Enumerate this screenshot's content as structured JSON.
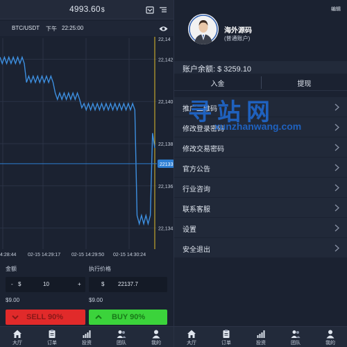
{
  "left": {
    "balance": "4993.60",
    "currency": "$",
    "pair": "BTC/USDT",
    "ampm": "下午",
    "clock": "22:25:00",
    "chart_data": {
      "type": "line",
      "x_labels": [
        "4:28:44",
        "02-15 14:29:17",
        "02-15 14:29:50",
        "02-15 14:30:24"
      ],
      "y_labels": [
        "22,142",
        "22,140",
        "22,138",
        "22,136",
        "22,134"
      ],
      "current_price_label": "22133",
      "ylim": [
        22133,
        22143
      ],
      "values": [
        22142.1,
        22141.8,
        22142.1,
        22141.8,
        22142.1,
        22141.8,
        22142.1,
        22141.8,
        22142.1,
        22141.8,
        22142.1,
        22141.8,
        22140.9,
        22141.2,
        22140.9,
        22141.2,
        22140.9,
        22141.2,
        22140.9,
        22141.2,
        22140.9,
        22141.2,
        22140.9,
        22141.2,
        22140.9,
        22140.4,
        22140.1,
        22140.4,
        22140.1,
        22140.4,
        22140.1,
        22140.4,
        22140.1,
        22140.4,
        22140.1,
        22140.4,
        22140.1,
        22139.7,
        22139.9,
        22139.6,
        22139.9,
        22139.6,
        22139.9,
        22139.6,
        22139.9,
        22139.6,
        22139.9,
        22139.6,
        22139.9,
        22139.6,
        22139.9,
        22139.6,
        22139.9,
        22139.6,
        22139.9,
        22139.6,
        22139.9,
        22139.6,
        22139.9,
        22139.6,
        22139.9,
        22139.6,
        22134.6,
        22134.2,
        22134.6,
        22134.2,
        22134.6,
        22134.2,
        22134.6,
        22138.5,
        22137.8
      ]
    },
    "amount_label": "金额",
    "price_label": "执行价格",
    "amount_minus": "-",
    "amount_currency": "$",
    "amount_value": "10",
    "amount_plus": "+",
    "price_currency": "$",
    "price_value": "22137.7",
    "amount_total": "$9.00",
    "price_total": "$9.00",
    "sell_label": "SELL 90%",
    "buy_label": "BUY 90%",
    "tabs": [
      {
        "label": "大厅",
        "icon": "home-icon"
      },
      {
        "label": "订单",
        "icon": "clipboard-icon"
      },
      {
        "label": "投资",
        "icon": "chart-icon"
      },
      {
        "label": "团队",
        "icon": "team-icon"
      },
      {
        "label": "我的",
        "icon": "user-icon"
      }
    ]
  },
  "right": {
    "edit_label": "编辑",
    "username": "海外源码",
    "account_type": "(普通账户)",
    "balance_label": "账户余额: $ 3259.10",
    "deposit_label": "入金",
    "withdraw_label": "提现",
    "watermark_big": "寻站网",
    "watermark_small": "xunzhanwang.com",
    "menu": [
      {
        "label": "推广二维码"
      },
      {
        "label": "修改登录密码"
      },
      {
        "label": "修改交易密码"
      },
      {
        "label": "官方公告"
      },
      {
        "label": "行业咨询"
      },
      {
        "label": "联系客服"
      },
      {
        "label": "设置"
      },
      {
        "label": "安全退出"
      }
    ],
    "tabs": [
      {
        "label": "大厅",
        "icon": "home-icon"
      },
      {
        "label": "订单",
        "icon": "clipboard-icon"
      },
      {
        "label": "投资",
        "icon": "chart-icon"
      },
      {
        "label": "团队",
        "icon": "team-icon"
      },
      {
        "label": "我的",
        "icon": "user-icon"
      }
    ]
  },
  "colors": {
    "bg": "#1b2231",
    "line": "#3d8fe0",
    "sell": "#e12a2a",
    "buy": "#3bd33b",
    "watermark": "#1e6edc",
    "price_badge": "#2e7fd4",
    "vertical_marker": "#e6c02a"
  }
}
